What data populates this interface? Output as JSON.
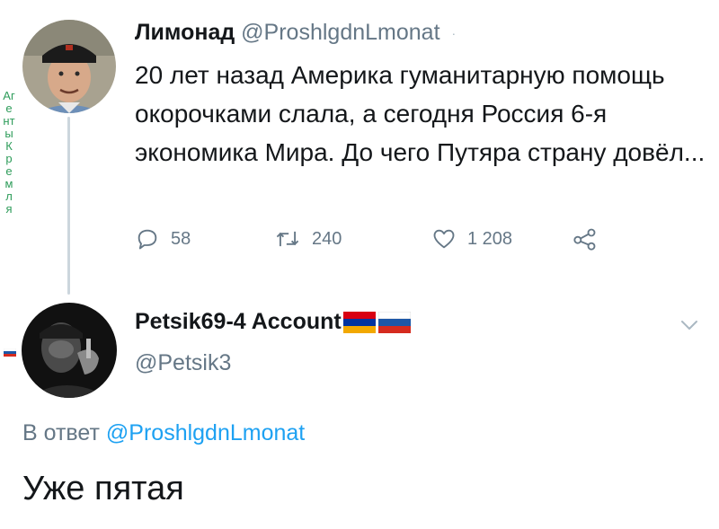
{
  "sidebar_caption": "Агенты Кремля",
  "tweet1": {
    "name": "Лимонад",
    "handle": "@ProshlgdnLmonat",
    "separator": "·",
    "text": "20 лет назад Америка гуманитарную помощь окорочками слала, а сегодня Россия 6-я экономика Мира. До чего Путяра страну довёл...",
    "actions": {
      "replies": "58",
      "retweets": "240",
      "likes": "1 208"
    }
  },
  "tweet2": {
    "name": "Petsik69-4 Account",
    "handle": "@Petsik3",
    "reply_prefix": "В ответ",
    "reply_to_handle": "@ProshlgdnLmonat",
    "text": "Уже пятая"
  },
  "icons": {
    "reply": "speech-bubble-icon",
    "retweet": "retweet-icon",
    "like": "heart-icon",
    "share": "share-icon",
    "menu": "chevron-down-icon",
    "flag_armenia": "armenia-flag-icon",
    "flag_russia": "russia-flag-icon"
  },
  "colors": {
    "text": "#14171a",
    "muted": "#657786",
    "link": "#1da1f2",
    "thread_line": "#ccd6dd",
    "sidebar_caption": "#2e9c5a"
  }
}
